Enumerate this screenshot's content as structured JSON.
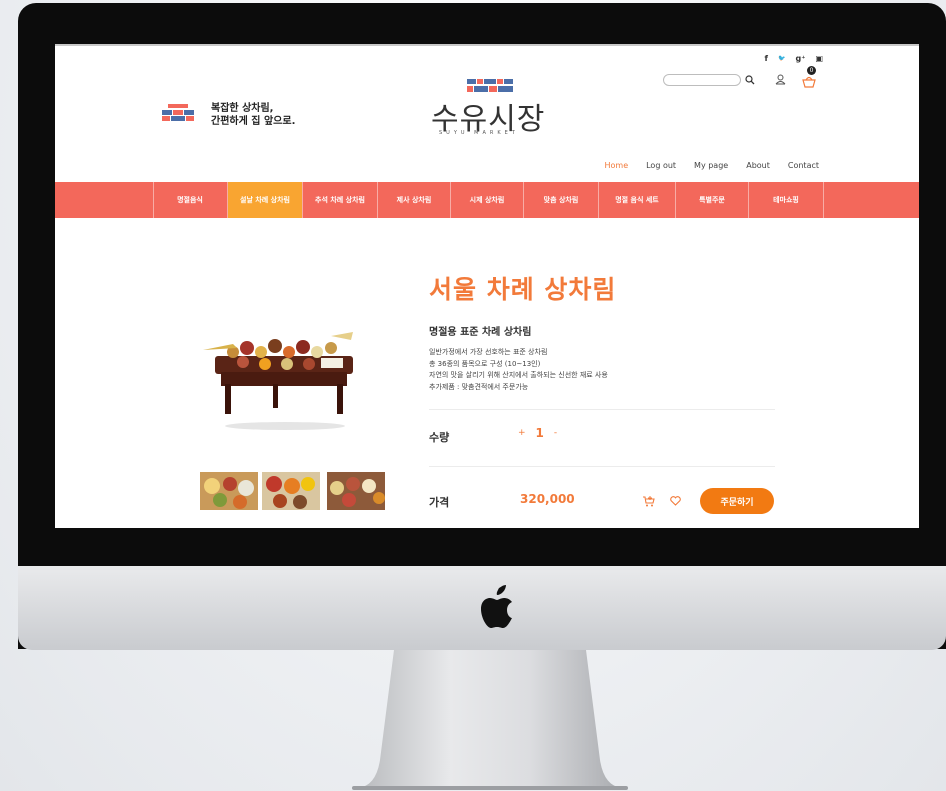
{
  "header": {
    "social_icons": [
      "facebook-icon",
      "twitter-icon",
      "google-plus-icon",
      "instagram-icon"
    ],
    "social_glyphs": [
      "f",
      "🐦",
      "g⁺",
      "▣"
    ],
    "search": {
      "placeholder": ""
    },
    "cart_count": "0",
    "slogan": "복잡한 상차림,\n간편하게 집 앞으로.",
    "brand": {
      "name": "수유시장",
      "en": "SUYU MARKET"
    },
    "top_nav": [
      "Home",
      "Log out",
      "My page",
      "About",
      "Contact"
    ],
    "top_nav_active": "Home"
  },
  "categories": [
    "명절음식",
    "설날 차례 상차림",
    "추석 차례 상차림",
    "제사 상차림",
    "시제 상차림",
    "맞춤 상차림",
    "명절 음식 세트",
    "특별주문",
    "테마쇼핑"
  ],
  "categories_active": "설날 차례 상차림",
  "product": {
    "title": "서울 차례 상차림",
    "subtitle": "명절용 표준 차례 상차림",
    "description": [
      "일반가정에서 가장 선호하는 표준 상차림",
      "총 36종의 품목으로 구성 (10~13인)",
      "자연의 맛을 살리기 위해 산지에서 출하되는 신선한 재료 사용",
      "추가제품 : 맞춤견적에서 주문가능"
    ],
    "quantity_label": "수량",
    "quantity_plus": "+",
    "quantity_value": "1",
    "quantity_minus": "-",
    "price_label": "가격",
    "price": "320,000",
    "order_button": "주문하기"
  },
  "colors": {
    "accent": "#f27a3a",
    "category_bar": "#f3685b",
    "active_category": "#f9a531"
  }
}
